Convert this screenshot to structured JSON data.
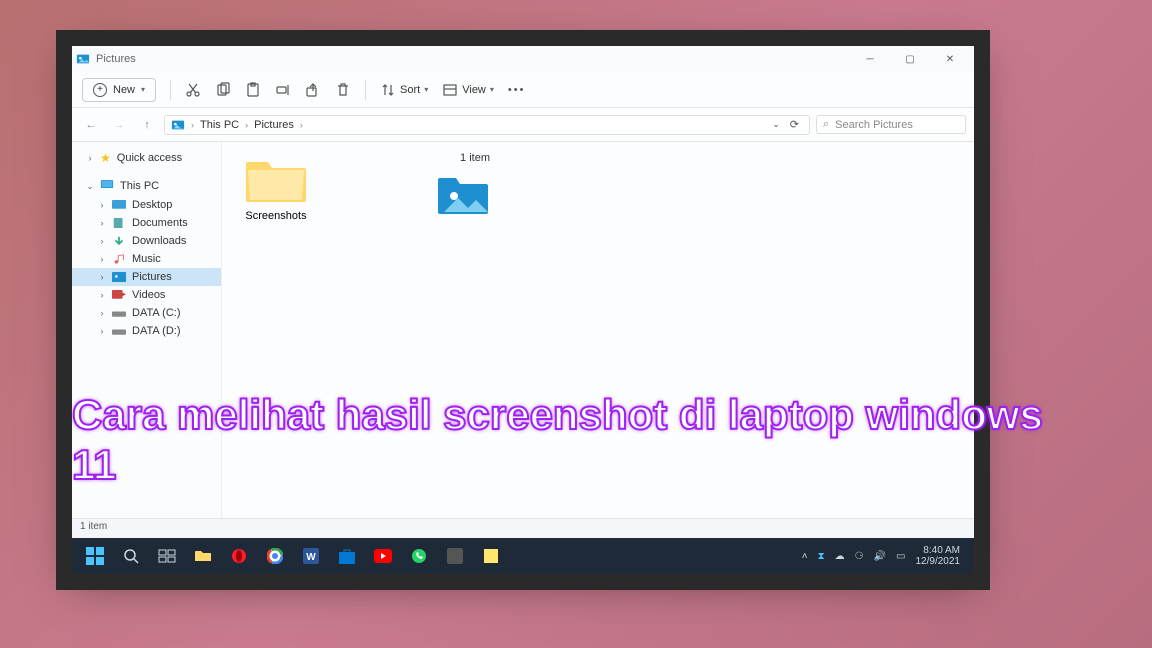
{
  "window": {
    "title": "Pictures"
  },
  "ribbon": {
    "new_label": "New",
    "sort_label": "Sort",
    "view_label": "View"
  },
  "breadcrumb": {
    "root": "This PC",
    "folder": "Pictures"
  },
  "search": {
    "placeholder": "Search Pictures"
  },
  "sidebar": {
    "quick_access": "Quick access",
    "this_pc": "This PC",
    "desktop": "Desktop",
    "documents": "Documents",
    "downloads": "Downloads",
    "music": "Music",
    "pictures": "Pictures",
    "videos": "Videos",
    "data_c": "DATA (C:)",
    "data_d": "DATA (D:)"
  },
  "content": {
    "folder_name": "Screenshots"
  },
  "details": {
    "count": "1 item"
  },
  "statusbar": {
    "count": "1 item"
  },
  "taskbar": {
    "time": "8:40 AM",
    "date": "12/9/2021"
  },
  "caption": "Cara melihat hasil screenshot di laptop windows 11"
}
